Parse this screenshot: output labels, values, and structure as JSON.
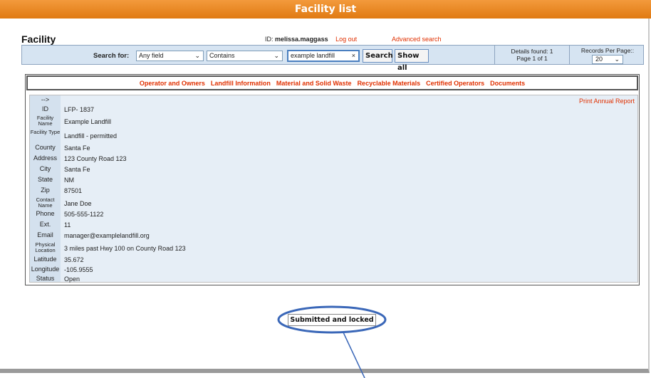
{
  "window": {
    "title": "Facility list"
  },
  "header": {
    "page_title": "Facility",
    "id_label": "ID:",
    "user_id": "melissa.maggass",
    "logout": "Log out",
    "advanced_search": "Advanced search"
  },
  "search": {
    "label": "Search for:",
    "field_value": "Any field",
    "condition_value": "Contains",
    "query": "example landfill",
    "clear_icon": "×",
    "search_button": "Search",
    "show_all_button": "Show all",
    "details_found": "Details found: 1",
    "page_info": "Page 1 of 1",
    "records_per_page_label": "Records Per Page::",
    "records_per_page_value": "20"
  },
  "tabs": [
    "Operator and Owners",
    "Landfill Information",
    "Material and Solid Waste",
    "Recyclable Materials",
    "Certified Operators",
    "Documents"
  ],
  "details": {
    "arrow": "-->",
    "print_link": "Print Annual Report",
    "rows": [
      {
        "label": "ID",
        "value": "LFP- 1837"
      },
      {
        "label": "Facility Name",
        "value": "Example Landfill"
      },
      {
        "label": "Facility Type",
        "value": "Landfill - permitted"
      },
      {
        "label": "County",
        "value": "Santa Fe"
      },
      {
        "label": "Address",
        "value": "123 County Road 123"
      },
      {
        "label": "City",
        "value": "Santa Fe"
      },
      {
        "label": "State",
        "value": "NM"
      },
      {
        "label": "Zip",
        "value": "87501"
      },
      {
        "label": "Contact Name",
        "value": "Jane Doe"
      },
      {
        "label": "Phone",
        "value": "505-555-1122"
      },
      {
        "label": "Ext.",
        "value": "11"
      },
      {
        "label": "Email",
        "value": "manager@examplelandfill.org"
      },
      {
        "label": "Physical Location",
        "value": "3 miles past Hwy 100 on County Road 123"
      },
      {
        "label": "Latitude",
        "value": "35.672"
      },
      {
        "label": "Longitude",
        "value": "-105.9555"
      },
      {
        "label": "Status",
        "value": "Open"
      }
    ]
  },
  "status_box": {
    "label": "Submitted and locked"
  },
  "colors": {
    "title_bar": "#e88424",
    "link": "#e03000",
    "search_bg": "#d6e4f2",
    "annotation": "#3a67b8"
  },
  "icons": [
    "chevron-down-icon",
    "clear-icon",
    "arrow-icon"
  ]
}
